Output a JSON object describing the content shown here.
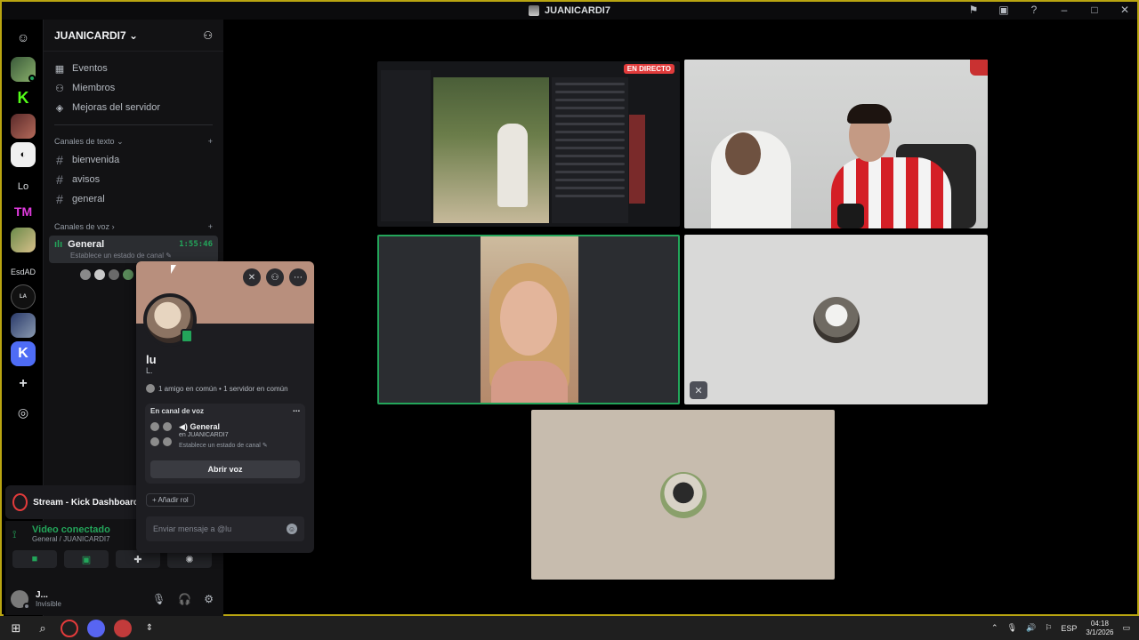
{
  "window": {
    "title": "JUANICARDI7",
    "controls": [
      "inbox-icon",
      "window-icon",
      "help-icon",
      "minimize-icon",
      "maximize-icon",
      "close-icon"
    ]
  },
  "rail": {
    "items": [
      {
        "name": "discord-home",
        "label": ""
      },
      {
        "name": "server-1",
        "label": ""
      },
      {
        "name": "server-kick",
        "label": ""
      },
      {
        "name": "server-3",
        "label": ""
      },
      {
        "name": "server-4",
        "label": ""
      },
      {
        "name": "server-lo",
        "label": "Lo"
      },
      {
        "name": "server-tm",
        "label": "TM"
      },
      {
        "name": "server-7",
        "label": ""
      },
      {
        "name": "server-esdad",
        "label": "EsdAD"
      },
      {
        "name": "server-la-tribu",
        "label": ""
      },
      {
        "name": "server-10",
        "label": ""
      },
      {
        "name": "server-k",
        "label": ""
      },
      {
        "name": "add-server",
        "label": "+"
      },
      {
        "name": "explore",
        "label": ""
      }
    ]
  },
  "sidebar": {
    "server_name": "JUANICARDI7",
    "nav": [
      {
        "label": "Eventos",
        "icon": "calendar-icon"
      },
      {
        "label": "Miembros",
        "icon": "members-icon"
      },
      {
        "label": "Mejoras del servidor",
        "icon": "boost-icon"
      }
    ],
    "text_section": "Canales de texto",
    "text_channels": [
      "bienvenida",
      "avisos",
      "general"
    ],
    "voice_section": "Canales de voz",
    "voice_channel": {
      "name": "General",
      "timer": "1:55:46",
      "status_hint": "Establece un estado de canal"
    }
  },
  "stream_panel": {
    "title": "Stream - Kick Dashboard"
  },
  "video_connected": {
    "title": "Video conectado",
    "subtitle": "General / JUANICARDI7"
  },
  "user_panel": {
    "name": "J...",
    "status": "Invisible"
  },
  "popout": {
    "name": "lu",
    "handle": "L.",
    "mutual": "1 amigo en común • 1 servidor en común",
    "voice_head": "En canal de voz",
    "voice_channel": "General",
    "voice_server": "en JUANICARDI7",
    "voice_hint": "Establece un estado de canal",
    "open_voice": "Abrir voz",
    "add_role": "+ Añadir rol",
    "message_placeholder": "Enviar mensaje a @lu"
  },
  "tiles": {
    "live_badge": "EN DIRECTO"
  },
  "taskbar": {
    "lang": "ESP",
    "time": "04:18",
    "date": "3/1/2026"
  },
  "colors": {
    "accent_green": "#23a55a",
    "frame_border": "#b9a511",
    "live_red": "#e03b3b"
  }
}
